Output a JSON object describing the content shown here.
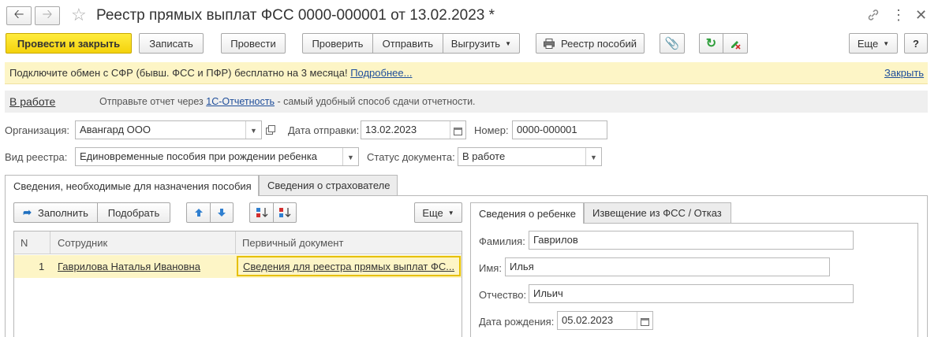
{
  "window": {
    "title": "Реестр прямых выплат ФСС 0000-000001 от 13.02.2023 *"
  },
  "toolbar": {
    "post_and_close": "Провести и закрыть",
    "save": "Записать",
    "post": "Провести",
    "check": "Проверить",
    "send": "Отправить",
    "upload": "Выгрузить",
    "benefits_register": "Реестр пособий",
    "more": "Еще",
    "help": "?"
  },
  "banner": {
    "text": "Подключите обмен с СФР (бывш. ФСС и ПФР) бесплатно на 3 месяца!",
    "more_link": "Подробнее...",
    "close_link": "Закрыть"
  },
  "status_bar": {
    "status": "В работе",
    "hint_prefix": "Отправьте отчет через",
    "hint_link": "1С-Отчетность",
    "hint_suffix": "- самый удобный способ сдачи отчетности."
  },
  "form": {
    "org_label": "Организация:",
    "org_value": "Авангард ООО",
    "send_date_label": "Дата отправки:",
    "send_date_value": "13.02.2023",
    "number_label": "Номер:",
    "number_value": "0000-000001",
    "register_type_label": "Вид реестра:",
    "register_type_value": "Единовременные пособия при рождении ребенка",
    "doc_status_label": "Статус документа:",
    "doc_status_value": "В работе"
  },
  "tabs": [
    {
      "label": "Сведения, необходимые для назначения пособия"
    },
    {
      "label": "Сведения о страхователе"
    }
  ],
  "left_panel": {
    "fill": "Заполнить",
    "select": "Подобрать",
    "more": "Еще",
    "table": {
      "headers": [
        "N",
        "Сотрудник",
        "Первичный документ"
      ],
      "rows": [
        {
          "n": "1",
          "employee": "Гаврилова Наталья Ивановна",
          "doc": "Сведения для реестра прямых выплат ФС..."
        }
      ]
    }
  },
  "right_panel": {
    "tabs": [
      {
        "label": "Сведения о ребенке"
      },
      {
        "label": "Извещение из ФСС / Отказ"
      }
    ],
    "surname_label": "Фамилия:",
    "surname_value": "Гаврилов",
    "name_label": "Имя:",
    "name_value": "Илья",
    "patronymic_label": "Отчество:",
    "patronymic_value": "Ильич",
    "birth_date_label": "Дата рождения:",
    "birth_date_value": "05.02.2023"
  },
  "colors": {
    "primary_button": "#f4d20c",
    "banner_bg": "#fdf5c6",
    "link": "#1f4e9a",
    "green_refresh": "#2e9e3a",
    "selected_row": "#fdf5c6"
  }
}
